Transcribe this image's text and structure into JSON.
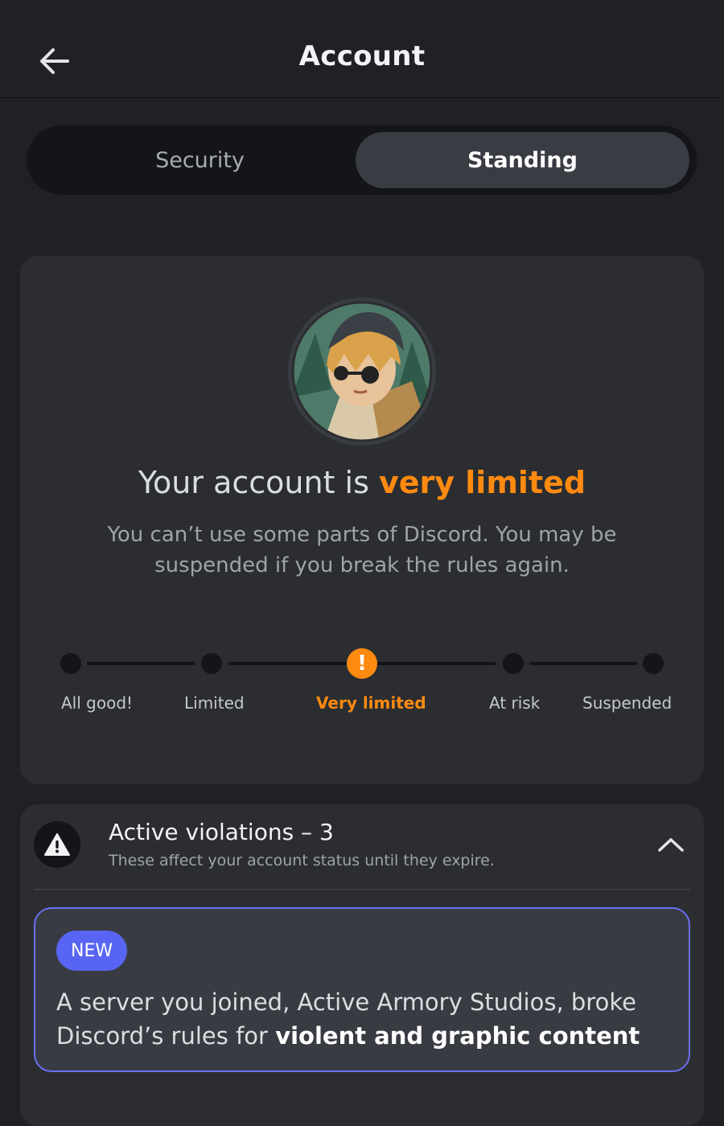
{
  "header": {
    "title": "Account",
    "back_icon": "arrow-left-icon"
  },
  "tabs": [
    {
      "label": "Security",
      "selected": false
    },
    {
      "label": "Standing",
      "selected": true
    }
  ],
  "standing": {
    "headline_prefix": "Your account is ",
    "headline_level": "very limited",
    "description": "You can’t use some parts of Discord. You may be suspended if you break the rules again.",
    "accent_color": "#ff8a10",
    "steps": [
      "All good!",
      "Limited",
      "Very limited",
      "At risk",
      "Suspended"
    ],
    "current_step": "Very limited",
    "current_marker": "!"
  },
  "violations": {
    "title": "Active violations – 3",
    "subtitle": "These affect your account status until they expire.",
    "icon": "warning-icon",
    "items": [
      {
        "badge": "NEW",
        "text_prefix": "A server you joined, Active Armory Studios, broke Discord’s rules for ",
        "text_bold": "violent and graphic content"
      }
    ]
  },
  "colors": {
    "background": "#202125",
    "card": "#2b2d31",
    "brand": "#5865f2"
  }
}
